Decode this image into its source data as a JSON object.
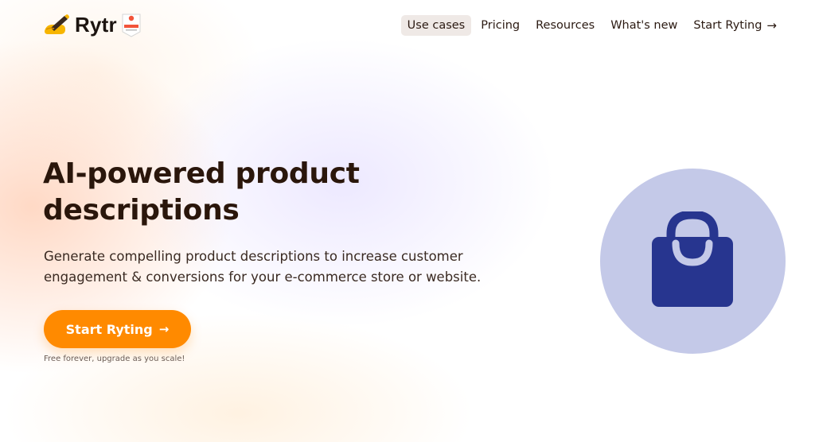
{
  "brand": {
    "name": "Rytr",
    "badge_text": "Leader"
  },
  "nav": {
    "items": [
      {
        "label": "Use cases",
        "active": true
      },
      {
        "label": "Pricing",
        "active": false
      },
      {
        "label": "Resources",
        "active": false
      },
      {
        "label": "What's new",
        "active": false
      },
      {
        "label": "Start Ryting",
        "active": false,
        "icon": "arrow-right-icon"
      }
    ]
  },
  "hero": {
    "title": "AI-powered product descriptions",
    "subtitle": "Generate compelling product descriptions to increase customer engagement & conversions for your e-commerce store or website.",
    "cta_label": "Start Ryting",
    "cta_icon": "arrow-right-icon",
    "cta_note": "Free forever, upgrade as you scale!"
  },
  "illustration": {
    "icon": "shopping-bag-icon",
    "circle_color": "#c4c9e8",
    "bag_color": "#27358f"
  },
  "colors": {
    "accent": "#ff8a00",
    "text": "#2a160b",
    "nav_active_bg": "#efe9e6"
  }
}
